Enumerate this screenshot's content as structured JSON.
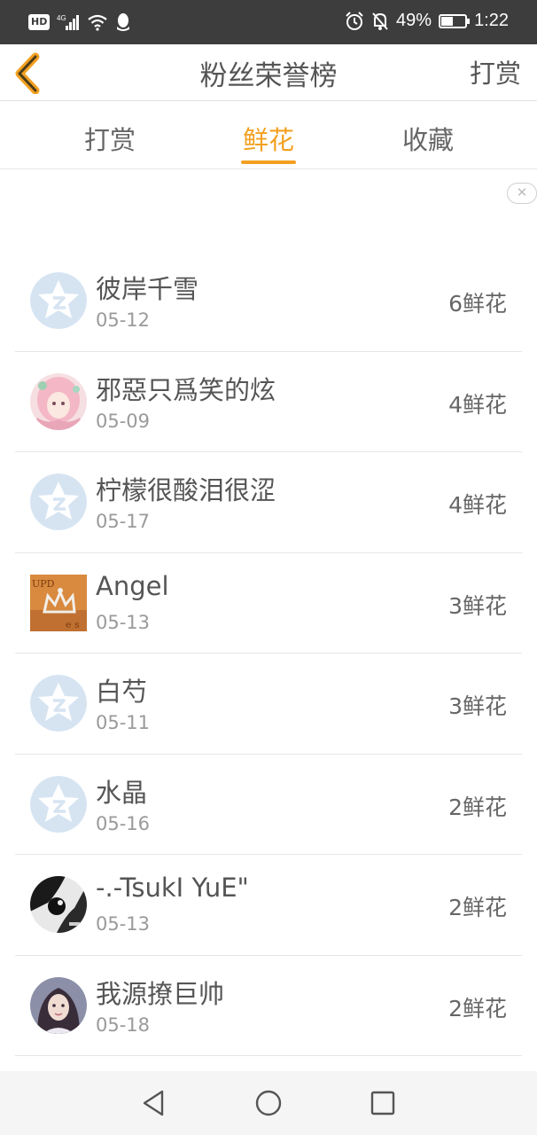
{
  "status_bar": {
    "hd": "HD",
    "network": "4G",
    "battery_percent": "49%",
    "battery_level": 0.49,
    "time": "1:22"
  },
  "header": {
    "title": "粉丝荣誉榜",
    "right_action": "打赏"
  },
  "tabs": [
    {
      "label": "打赏",
      "active": false
    },
    {
      "label": "鲜花",
      "active": true
    },
    {
      "label": "收藏",
      "active": false
    }
  ],
  "ad_close_icon": "close-icon",
  "fans": [
    {
      "name": "彼岸千雪",
      "date": "05-12",
      "count": "6鲜花",
      "avatar": "default-avatar-icon"
    },
    {
      "name": "邪惡只爲笑的炫",
      "date": "05-09",
      "count": "4鲜花",
      "avatar": "anime-girl-avatar"
    },
    {
      "name": "柠檬很酸泪很涩",
      "date": "05-17",
      "count": "4鲜花",
      "avatar": "default-avatar-icon"
    },
    {
      "name": "Angel",
      "date": "05-13",
      "count": "3鲜花",
      "avatar": "crown-photo-avatar"
    },
    {
      "name": "白芍",
      "date": "05-11",
      "count": "3鲜花",
      "avatar": "default-avatar-icon"
    },
    {
      "name": "水晶",
      "date": "05-16",
      "count": "2鲜花",
      "avatar": "default-avatar-icon"
    },
    {
      "name": "-.-TsukI YuE\"",
      "date": "05-13",
      "count": "2鲜花",
      "avatar": "bw-photo-avatar"
    },
    {
      "name": "我源撩巨帅",
      "date": "05-18",
      "count": "2鲜花",
      "avatar": "portrait-photo-avatar"
    }
  ],
  "colors": {
    "accent": "#f3a020",
    "status_bar_bg": "#3d3d3d",
    "default_avatar": "#d6e4f2"
  },
  "nav": [
    "back-triangle-icon",
    "home-circle-icon",
    "recents-square-icon"
  ]
}
